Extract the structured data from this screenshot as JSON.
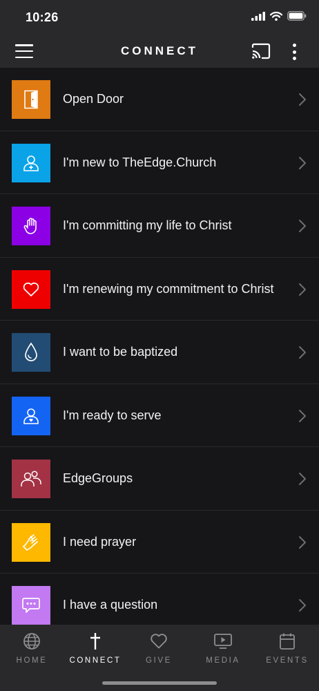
{
  "status_bar": {
    "time": "10:26"
  },
  "header": {
    "title": "CONNECT"
  },
  "rows": [
    {
      "label": "Open Door",
      "color": "#e07a12",
      "icon": "door-icon"
    },
    {
      "label": "I'm new to TheEdge.Church",
      "color": "#0aa3e8",
      "icon": "person-plus-icon"
    },
    {
      "label": "I'm committing my life to Christ",
      "color": "#8c00e6",
      "icon": "raised-hand-icon"
    },
    {
      "label": "I'm renewing my commitment to Christ",
      "color": "#ee0000",
      "icon": "heart-icon"
    },
    {
      "label": "I want to be baptized",
      "color": "#224c74",
      "icon": "water-drop-icon"
    },
    {
      "label": "I'm ready to serve",
      "color": "#1464f4",
      "icon": "person-heart-icon"
    },
    {
      "label": "EdgeGroups",
      "color": "#a33245",
      "icon": "group-icon"
    },
    {
      "label": "I need prayer",
      "color": "#ffb800",
      "icon": "praying-hands-icon"
    },
    {
      "label": "I have a question",
      "color": "#c279f1",
      "icon": "chat-bubble-icon"
    }
  ],
  "tabs": [
    {
      "label": "HOME",
      "icon": "globe-icon",
      "active": false
    },
    {
      "label": "CONNECT",
      "icon": "cross-icon",
      "active": true
    },
    {
      "label": "GIVE",
      "icon": "heart-icon",
      "active": false
    },
    {
      "label": "MEDIA",
      "icon": "play-screen-icon",
      "active": false
    },
    {
      "label": "EVENTS",
      "icon": "calendar-icon",
      "active": false
    }
  ]
}
